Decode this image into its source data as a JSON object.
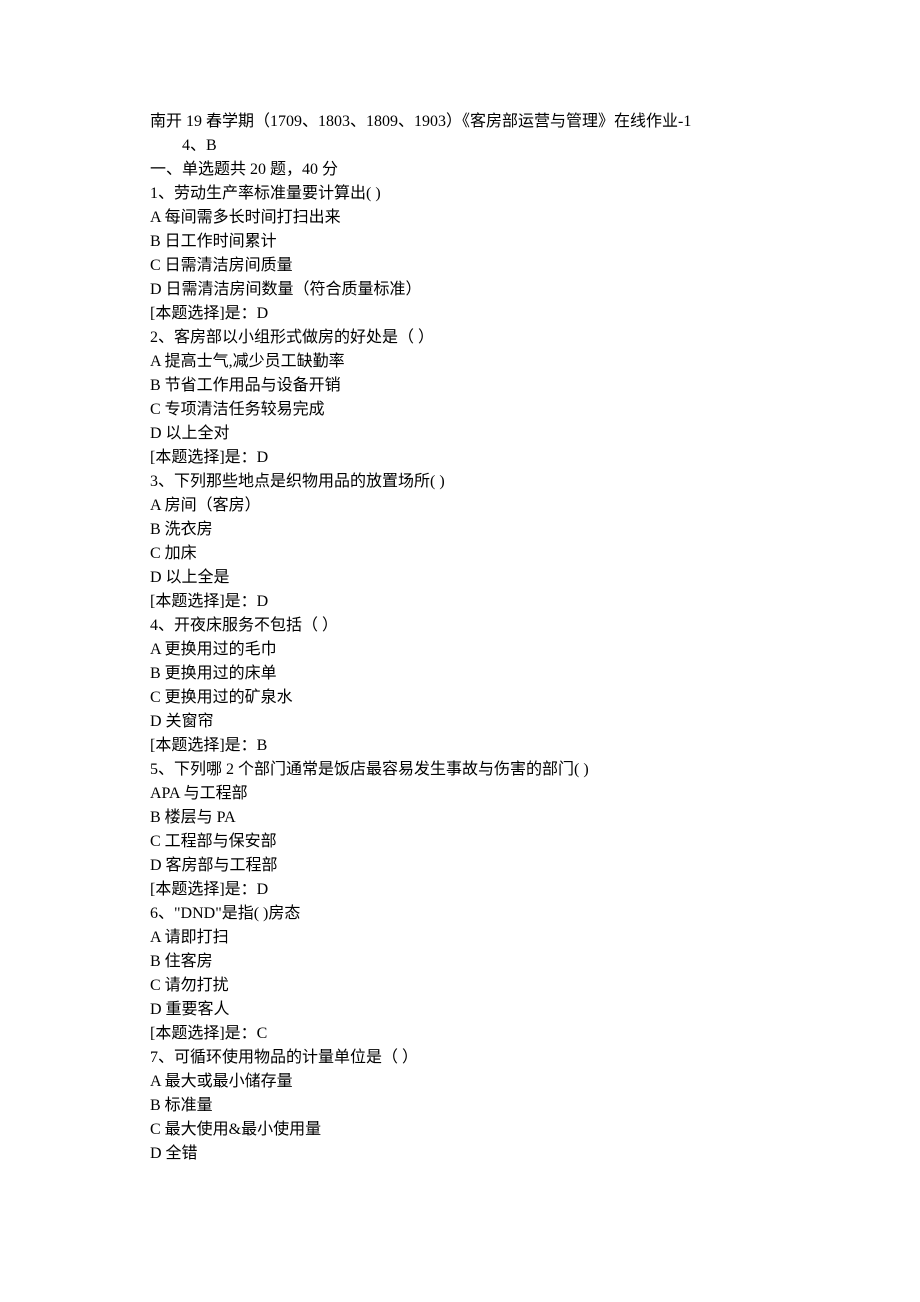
{
  "header": {
    "title": "南开 19 春学期（1709、1803、1809、1903）《客房部运营与管理》在线作业-1",
    "sub": "4、B"
  },
  "section": {
    "label": "一、单选题共 20 题，40 分"
  },
  "questions": [
    {
      "num": "1",
      "stem": "劳动生产率标准量要计算出( )",
      "options": [
        "A 每间需多长时间打扫出来",
        "B 日工作时间累计",
        "C 日需清洁房间质量",
        "D 日需清洁房间数量（符合质量标准）"
      ],
      "answer": "[本题选择]是：D"
    },
    {
      "num": "2",
      "stem": "客房部以小组形式做房的好处是（ ）",
      "options": [
        "A 提高士气,减少员工缺勤率",
        "B 节省工作用品与设备开销",
        "C 专项清洁任务较易完成",
        "D 以上全对"
      ],
      "answer": "[本题选择]是：D"
    },
    {
      "num": "3",
      "stem": "下列那些地点是织物用品的放置场所( )",
      "options": [
        "A 房间（客房）",
        "B 洗衣房",
        "C 加床",
        "D 以上全是"
      ],
      "answer": "[本题选择]是：D"
    },
    {
      "num": "4",
      "stem": "开夜床服务不包括（ ）",
      "options": [
        "A 更换用过的毛巾",
        "B 更换用过的床单",
        "C 更换用过的矿泉水",
        "D 关窗帘"
      ],
      "answer": "[本题选择]是：B"
    },
    {
      "num": "5",
      "stem": "下列哪 2 个部门通常是饭店最容易发生事故与伤害的部门( )",
      "options": [
        "APA 与工程部",
        "B 楼层与 PA",
        "C 工程部与保安部",
        "D 客房部与工程部"
      ],
      "answer": "[本题选择]是：D"
    },
    {
      "num": "6",
      "stem": "\"DND\"是指( )房态",
      "options": [
        "A 请即打扫",
        "B 住客房",
        "C 请勿打扰",
        "D 重要客人"
      ],
      "answer": "[本题选择]是：C"
    },
    {
      "num": "7",
      "stem": "可循环使用物品的计量单位是（ ）",
      "options": [
        "A 最大或最小储存量",
        "B 标准量",
        "C 最大使用&最小使用量",
        "D 全错"
      ],
      "answer": ""
    }
  ]
}
